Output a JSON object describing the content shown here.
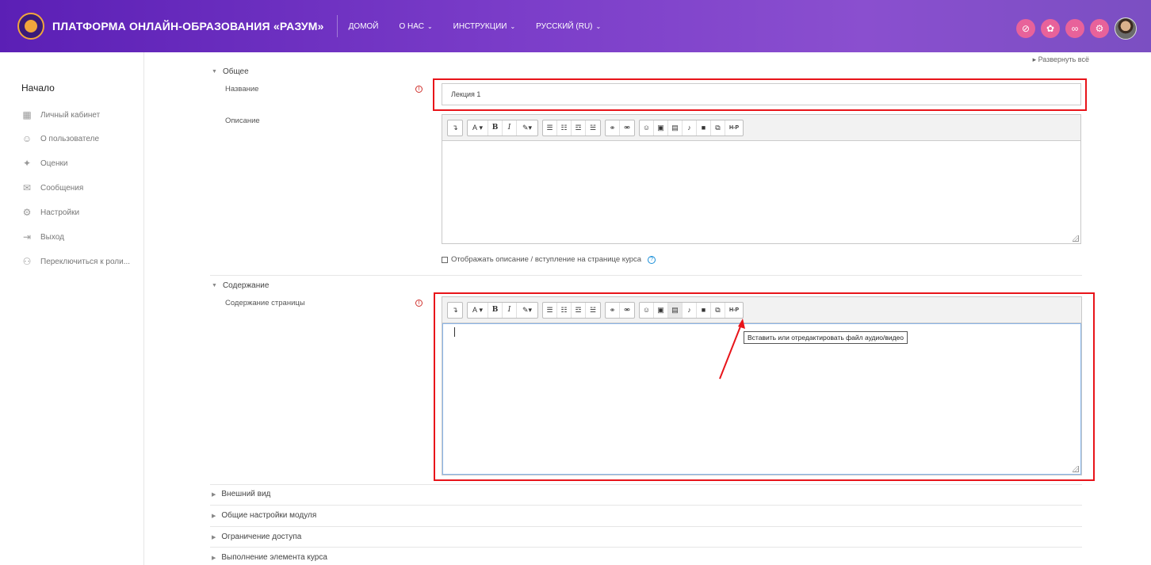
{
  "header": {
    "brand": "ПЛАТФОРМА ОНЛАЙН-ОБРАЗОВАНИЯ «РАЗУМ»",
    "nav": [
      {
        "label": "ДОМОЙ",
        "dropdown": false
      },
      {
        "label": "О НАС",
        "dropdown": true
      },
      {
        "label": "ИНСТРУКЦИИ",
        "dropdown": true
      },
      {
        "label": "РУССКИЙ (RU)",
        "dropdown": true
      }
    ],
    "accent_color": "#7b3dc9",
    "icon_color": "#e8629a",
    "right_icons": [
      "eye-off-icon",
      "puzzle-icon",
      "link-icon",
      "gear-icon"
    ]
  },
  "sidebar": {
    "title": "Начало",
    "items": [
      {
        "label": "Личный кабинет",
        "icon": "dashboard-icon"
      },
      {
        "label": "О пользователе",
        "icon": "user-profile-icon"
      },
      {
        "label": "Оценки",
        "icon": "grades-icon"
      },
      {
        "label": "Сообщения",
        "icon": "messages-icon"
      },
      {
        "label": "Настройки",
        "icon": "settings-icon"
      },
      {
        "label": "Выход",
        "icon": "logout-icon"
      },
      {
        "label": "Переключиться к роли...",
        "icon": "switch-role-icon"
      }
    ]
  },
  "form": {
    "expand_all": "Развернуть всё",
    "general": {
      "header": "Общее",
      "name_label": "Название",
      "name_value": "Лекция 1",
      "description_label": "Описание",
      "show_description": "Отображать описание / вступление на странице курса"
    },
    "content": {
      "header": "Содержание",
      "page_content_label": "Содержание страницы",
      "tooltip": "Вставить или отредактировать файл аудио/видео"
    },
    "collapsed_sections": [
      "Внешний вид",
      "Общие настройки модуля",
      "Ограничение доступа",
      "Выполнение элемента курса"
    ]
  },
  "toolbar": {
    "h5p_label": "H-P",
    "bold": "B",
    "italic": "I",
    "font": "A"
  },
  "highlight_color": "#e8141a"
}
